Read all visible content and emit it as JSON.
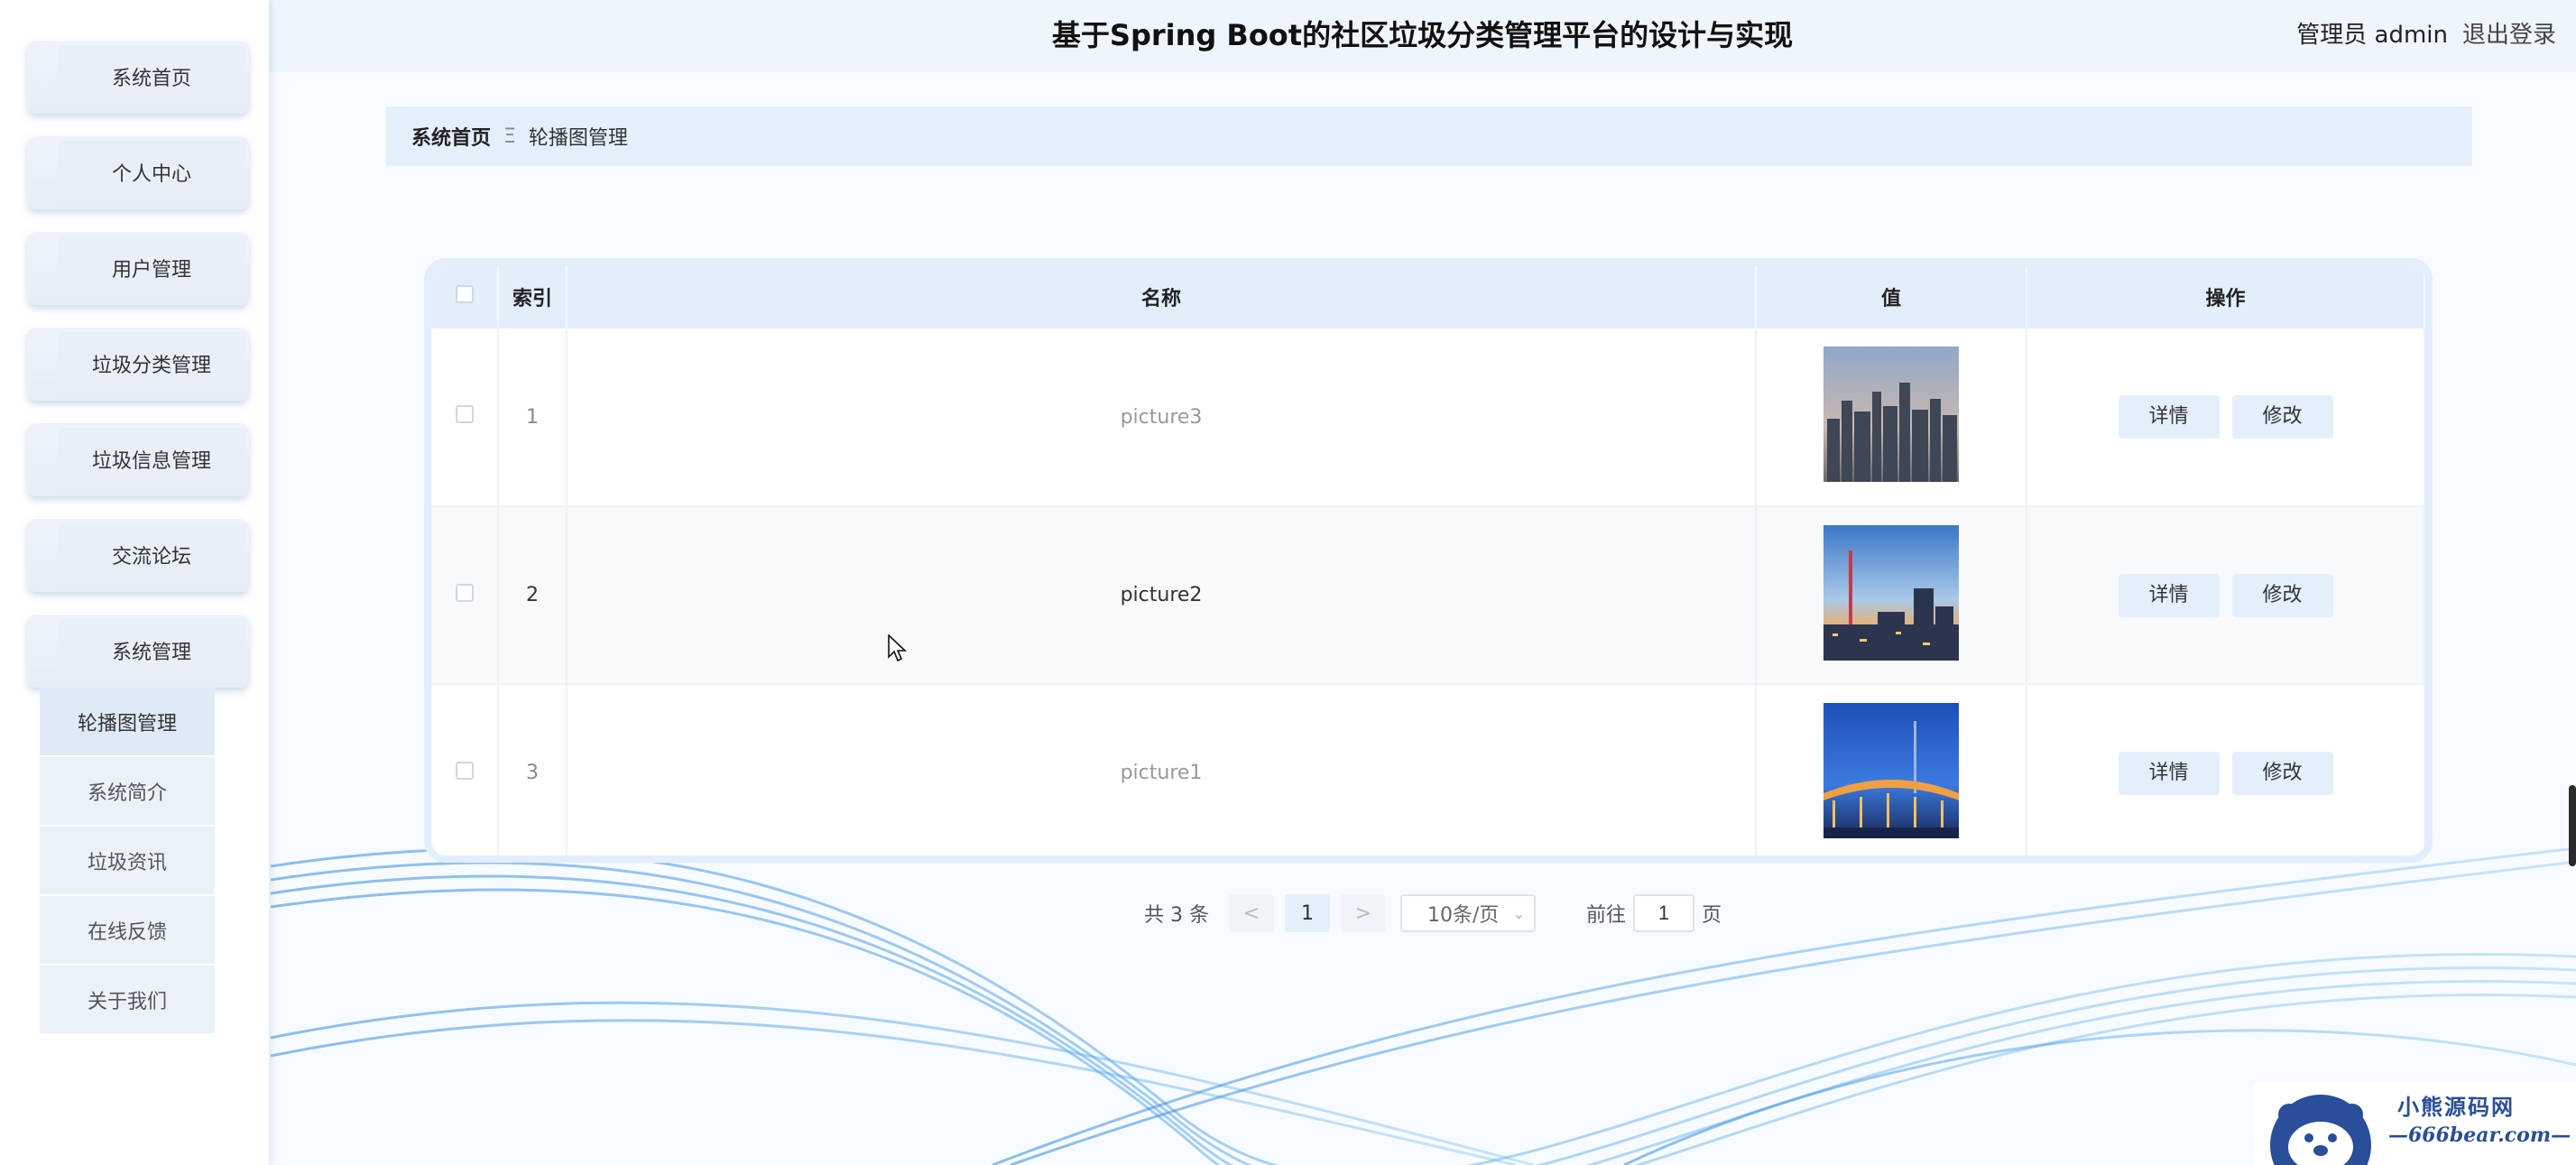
{
  "header": {
    "title": "基于Spring Boot的社区垃圾分类管理平台的设计与实现",
    "user_label": "管理员 admin",
    "logout_label": "退出登录"
  },
  "sidebar": {
    "items": [
      {
        "label": "系统首页"
      },
      {
        "label": "个人中心"
      },
      {
        "label": "用户管理"
      },
      {
        "label": "垃圾分类管理"
      },
      {
        "label": "垃圾信息管理"
      },
      {
        "label": "交流论坛"
      },
      {
        "label": "系统管理"
      }
    ],
    "submenu": [
      {
        "label": "轮播图管理"
      },
      {
        "label": "系统简介"
      },
      {
        "label": "垃圾资讯"
      },
      {
        "label": "在线反馈"
      },
      {
        "label": "关于我们"
      }
    ]
  },
  "breadcrumb": {
    "home": "系统首页",
    "separator": "Ξ",
    "current": "轮播图管理"
  },
  "table": {
    "headers": {
      "index": "索引",
      "name": "名称",
      "value": "值",
      "actions": "操作"
    },
    "rows": [
      {
        "index": "1",
        "name": "picture3",
        "image": "city-skyline-image"
      },
      {
        "index": "2",
        "name": "picture2",
        "image": "tower-dusk-image"
      },
      {
        "index": "3",
        "name": "picture1",
        "image": "bridge-night-image"
      }
    ],
    "detail_label": "详情",
    "edit_label": "修改"
  },
  "pagination": {
    "total": "共 3 条",
    "prev": "<",
    "page": "1",
    "next": ">",
    "page_size": "10条/页",
    "goto_prefix": "前往",
    "goto_value": "1",
    "goto_suffix": "页"
  },
  "watermark": {
    "line1": "小熊源码网",
    "line2": "—666bear.com—"
  },
  "colors": {
    "accent": "#e4effc",
    "brand_watermark": "#2a4e9a"
  }
}
